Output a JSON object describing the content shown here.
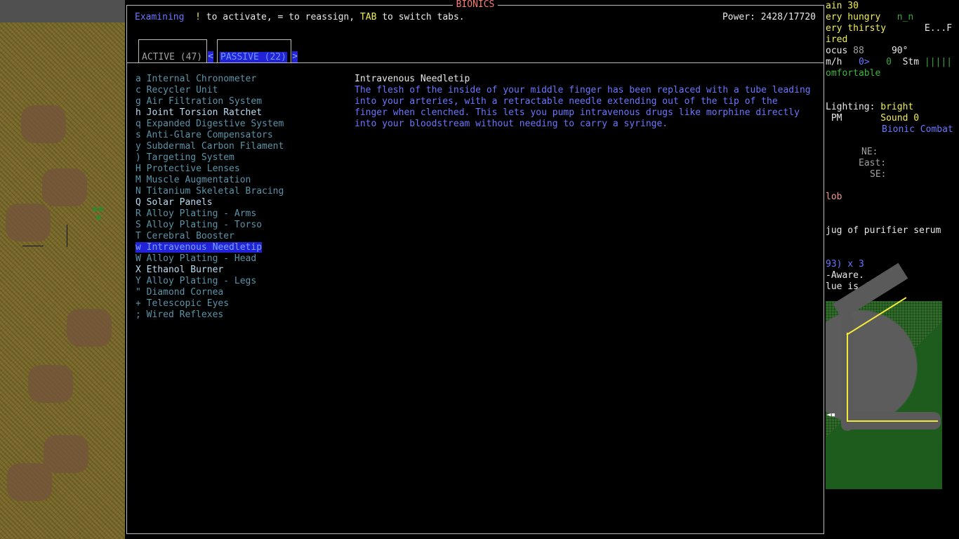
{
  "window": {
    "title": "BIONICS"
  },
  "top_bar": {
    "mode": "Examining",
    "activate_key": "!",
    "activate_text": " to activate, = to reassign, ",
    "tab_key": "TAB",
    "tab_text": " to switch tabs.",
    "power": "Power: 2428/17720"
  },
  "tabs": {
    "active_label": "ACTIVE (47)",
    "passive_label": "PASSIVE (22)",
    "prev_arrow": "<",
    "next_arrow": ">"
  },
  "bionics": [
    {
      "key": "a",
      "name": "Internal Chronometer",
      "bright": false
    },
    {
      "key": "c",
      "name": "Recycler Unit",
      "bright": false
    },
    {
      "key": "g",
      "name": "Air Filtration System",
      "bright": false
    },
    {
      "key": "h",
      "name": "Joint Torsion Ratchet",
      "bright": true
    },
    {
      "key": "q",
      "name": "Expanded Digestive System",
      "bright": false
    },
    {
      "key": "s",
      "name": "Anti-Glare Compensators",
      "bright": false
    },
    {
      "key": "y",
      "name": "Subdermal Carbon Filament",
      "bright": false
    },
    {
      "key": ")",
      "name": "Targeting System",
      "bright": false
    },
    {
      "key": "H",
      "name": "Protective Lenses",
      "bright": false
    },
    {
      "key": "M",
      "name": "Muscle Augmentation",
      "bright": false
    },
    {
      "key": "N",
      "name": "Titanium Skeletal Bracing",
      "bright": false
    },
    {
      "key": "Q",
      "name": "Solar Panels",
      "bright": true
    },
    {
      "key": "R",
      "name": "Alloy Plating - Arms",
      "bright": false
    },
    {
      "key": "S",
      "name": "Alloy Plating - Torso",
      "bright": false
    },
    {
      "key": "T",
      "name": "Cerebral Booster",
      "bright": false
    },
    {
      "key": "w",
      "name": "Intravenous Needletip",
      "bright": false,
      "selected": true
    },
    {
      "key": "W",
      "name": "Alloy Plating - Head",
      "bright": false
    },
    {
      "key": "X",
      "name": "Ethanol Burner",
      "bright": true
    },
    {
      "key": "Y",
      "name": "Alloy Plating - Legs",
      "bright": false
    },
    {
      "key": "\"",
      "name": "Diamond Cornea",
      "bright": false
    },
    {
      "key": "+",
      "name": "Telescopic Eyes",
      "bright": false
    },
    {
      "key": ";",
      "name": "Wired Reflexes",
      "bright": false
    }
  ],
  "description": {
    "title": "Intravenous Needletip",
    "body": "The flesh of the inside of your middle finger has been replaced with a tube leading\ninto your arteries, with a retractable needle extending out of the tip of the\nfinger when clenched.  This lets you pump intravenous drugs like morphine directly\ninto your bloodstream without needing to carry a syringe."
  },
  "sidebar": {
    "pain": "ain 30",
    "hunger": "ery hungry",
    "hunger_face": "n_n",
    "thirst": "ery thirsty",
    "thirst_right": "E...F",
    "tired": "ired",
    "focus_label": "ocus",
    "focus_value": "88",
    "temp": "90°",
    "speed_label": "m/h",
    "speed_arrow": "0>",
    "speed_value": "0",
    "stm_label": "Stm",
    "stm_bar": "|||||",
    "comfort": "omfortable",
    "lighting_label": "Lighting:",
    "lighting_value": "bright",
    "time": "PM",
    "sound": "Sound 0",
    "combat": "Bionic Combat",
    "dir_ne": "NE:",
    "dir_east": "East:",
    "dir_se": "SE:",
    "log1": "lob",
    "log2": "jug of purifier serum",
    "log3": "93) x 3",
    "log4": "-Aware.",
    "log5": "lue is 4."
  },
  "colors": {
    "selected_bg": "#2223d8",
    "title": "#f27d73",
    "highlight_key": "#f2ee57",
    "description": "#6a76ff"
  }
}
